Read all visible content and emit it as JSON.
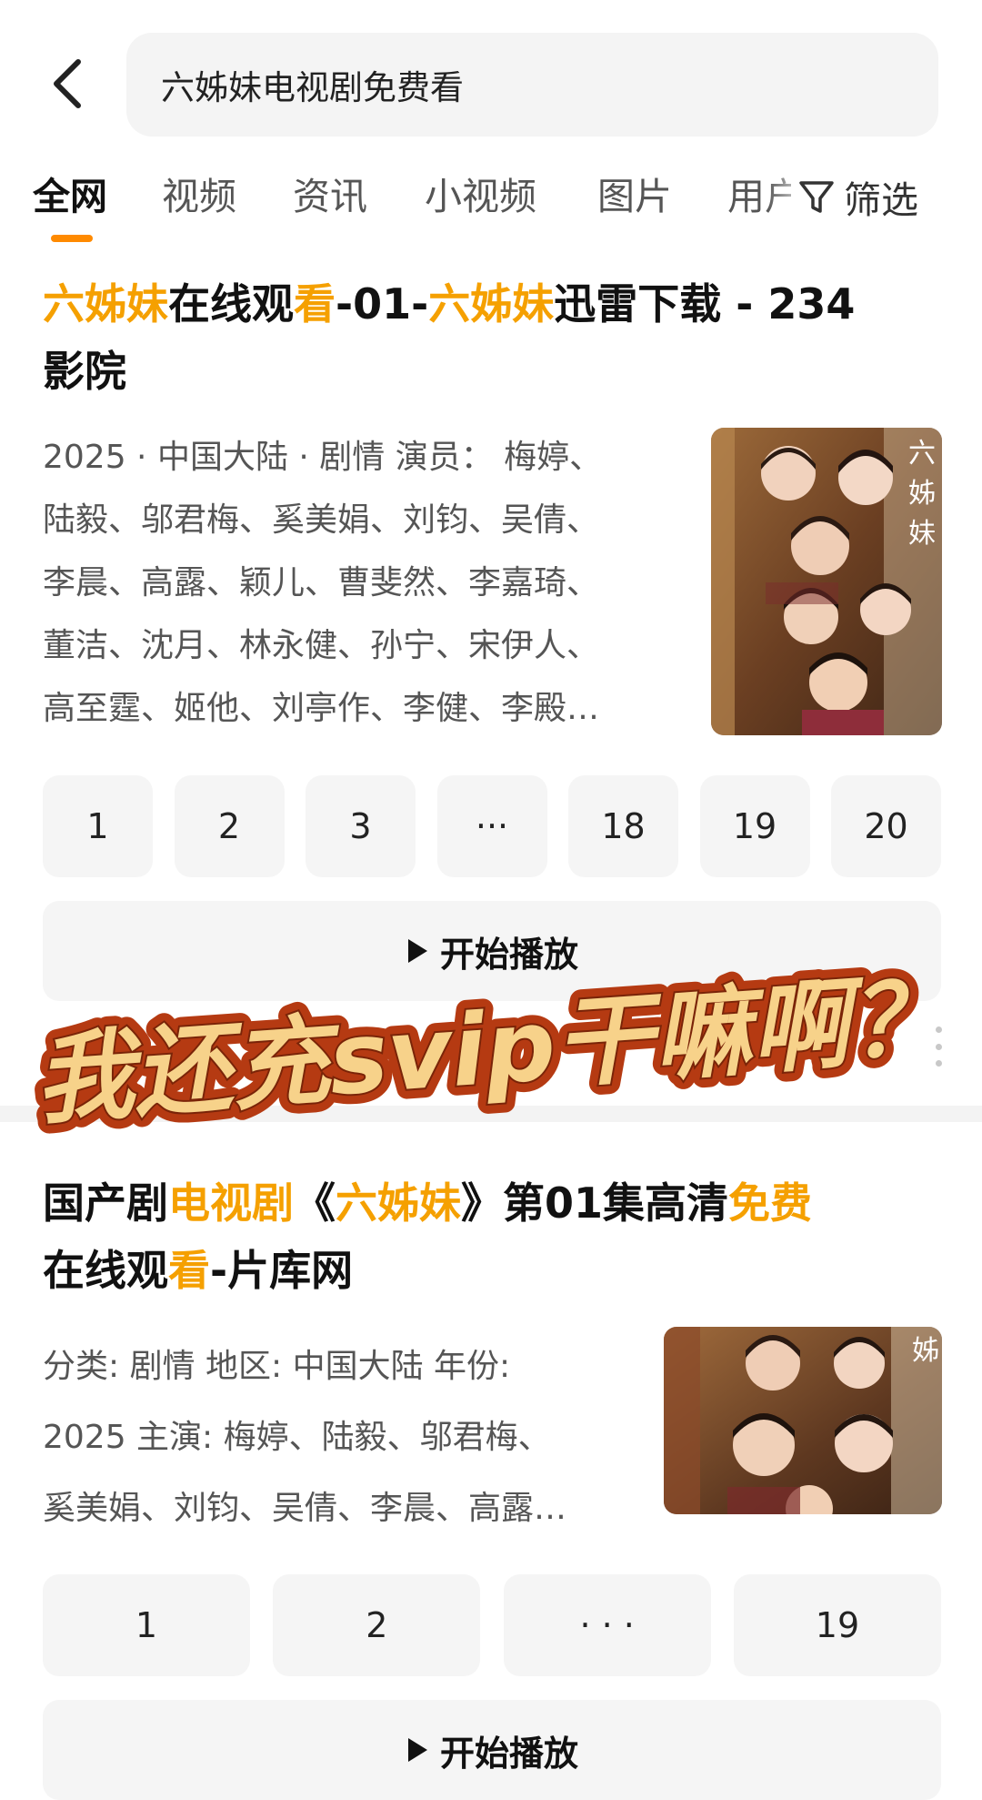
{
  "search": {
    "query": "六姊妹电视剧免费看"
  },
  "tabs": [
    {
      "label": "全网"
    },
    {
      "label": "视频"
    },
    {
      "label": "资讯"
    },
    {
      "label": "小视频"
    },
    {
      "label": "图片"
    },
    {
      "label": "用户"
    }
  ],
  "filter": {
    "label": "筛选"
  },
  "result1": {
    "title_parts": [
      "六姊妹",
      "在线观",
      "看",
      "-01-",
      "六姊妹",
      "迅雷下载 - 234",
      "影院"
    ],
    "desc_lines": [
      "2025 · 中国大陆 · 剧情 演员： 梅婷、",
      "陆毅、邬君梅、奚美娟、刘钧、吴倩、",
      "李晨、高露、颖儿、曹斐然、李嘉琦、",
      "董洁、沈月、林永健、孙宁、宋伊人、",
      "高至霆、姬他、刘亭作、李健、李殿…"
    ],
    "poster_text": "六姊妹",
    "episodes": [
      "1",
      "2",
      "3",
      "···",
      "18",
      "19",
      "20"
    ],
    "play_label": "开始播放"
  },
  "result2": {
    "title_parts": [
      "国产剧",
      "电视剧",
      "《",
      "六姊妹",
      "》第01集高清",
      "免费",
      "在线观",
      "看",
      "-片库网"
    ],
    "desc_lines": [
      "分类: 剧情 地区: 中国大陆 年份:",
      "2025 主演: 梅婷、陆毅、邬君梅、",
      "奚美娟、刘钧、吴倩、李晨、高露…"
    ],
    "poster_text": "姊",
    "episodes": [
      "1",
      "2",
      "· · ·",
      "19"
    ],
    "play_label": "开始播放"
  },
  "sticker": {
    "text": "我还充svip干嘛啊？"
  },
  "colors": {
    "highlight": "#f5a000",
    "accent": "#ff8a00",
    "sticker_fill": "#f7d28a",
    "sticker_outline": "#c2410c"
  }
}
